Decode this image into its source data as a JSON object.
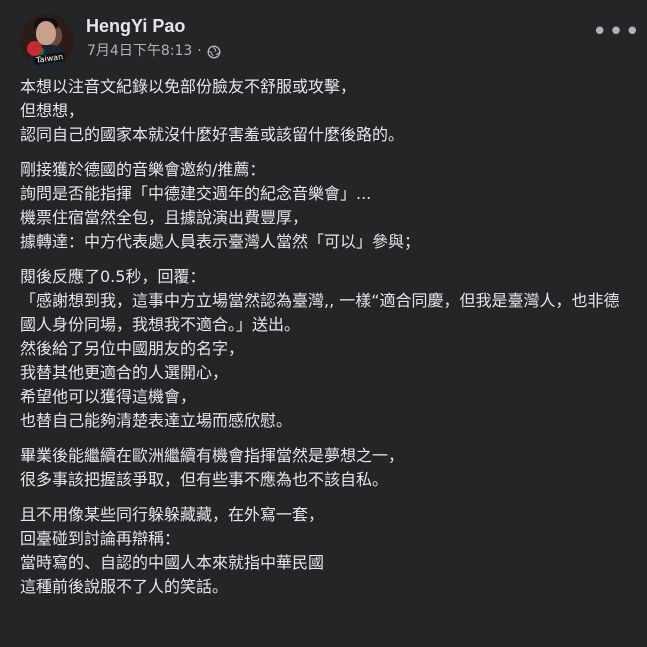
{
  "post": {
    "author": {
      "name": "HengYi Pao",
      "avatar_label": "Taiwan"
    },
    "meta": {
      "timestamp": "7月4日下午8:13",
      "separator": "·",
      "privacy_icon": "globe-icon"
    },
    "more_button": {
      "label": "•••",
      "icon": "more-horizontal-icon"
    },
    "content": {
      "paragraphs": [
        [
          "本想以注音文紀錄以免部份臉友不舒服或攻擊，",
          "但想想，",
          "認同自己的國家本就沒什麼好害羞或該留什麼後路的。"
        ],
        [
          "剛接獲於德國的音樂會邀約/推薦：",
          "詢問是否能指揮「中德建交週年的紀念音樂會」...",
          "機票住宿當然全包，且據說演出費豐厚，",
          "據轉達：中方代表處人員表示臺灣人當然「可以」參與；"
        ],
        [
          "閱後反應了0.5秒，回覆：",
          "「感謝想到我，這事中方立場當然認為臺灣,, 一樣“適合同慶，但我是臺灣人，也非德國人身份同場，我想我不適合。」送出。",
          "然後給了另位中國朋友的名字，",
          "我替其他更適合的人選開心，",
          "希望他可以獲得這機會，",
          "也替自己能夠清楚表達立場而感欣慰。"
        ],
        [
          "畢業後能繼續在歐洲繼續有機會指揮當然是夢想之一，",
          "很多事該把握該爭取，但有些事不應為也不該自私。"
        ],
        [
          "且不用像某些同行躲躲藏藏，在外寫一套，",
          "回臺碰到討論再辯稱：",
          "當時寫的、自認的中國人本來就指中華民國",
          "這種前後說服不了人的笑話。"
        ]
      ]
    },
    "colors": {
      "background": "#242526",
      "primary_text": "#e4e6eb",
      "secondary_text": "#b0b3b8"
    }
  }
}
